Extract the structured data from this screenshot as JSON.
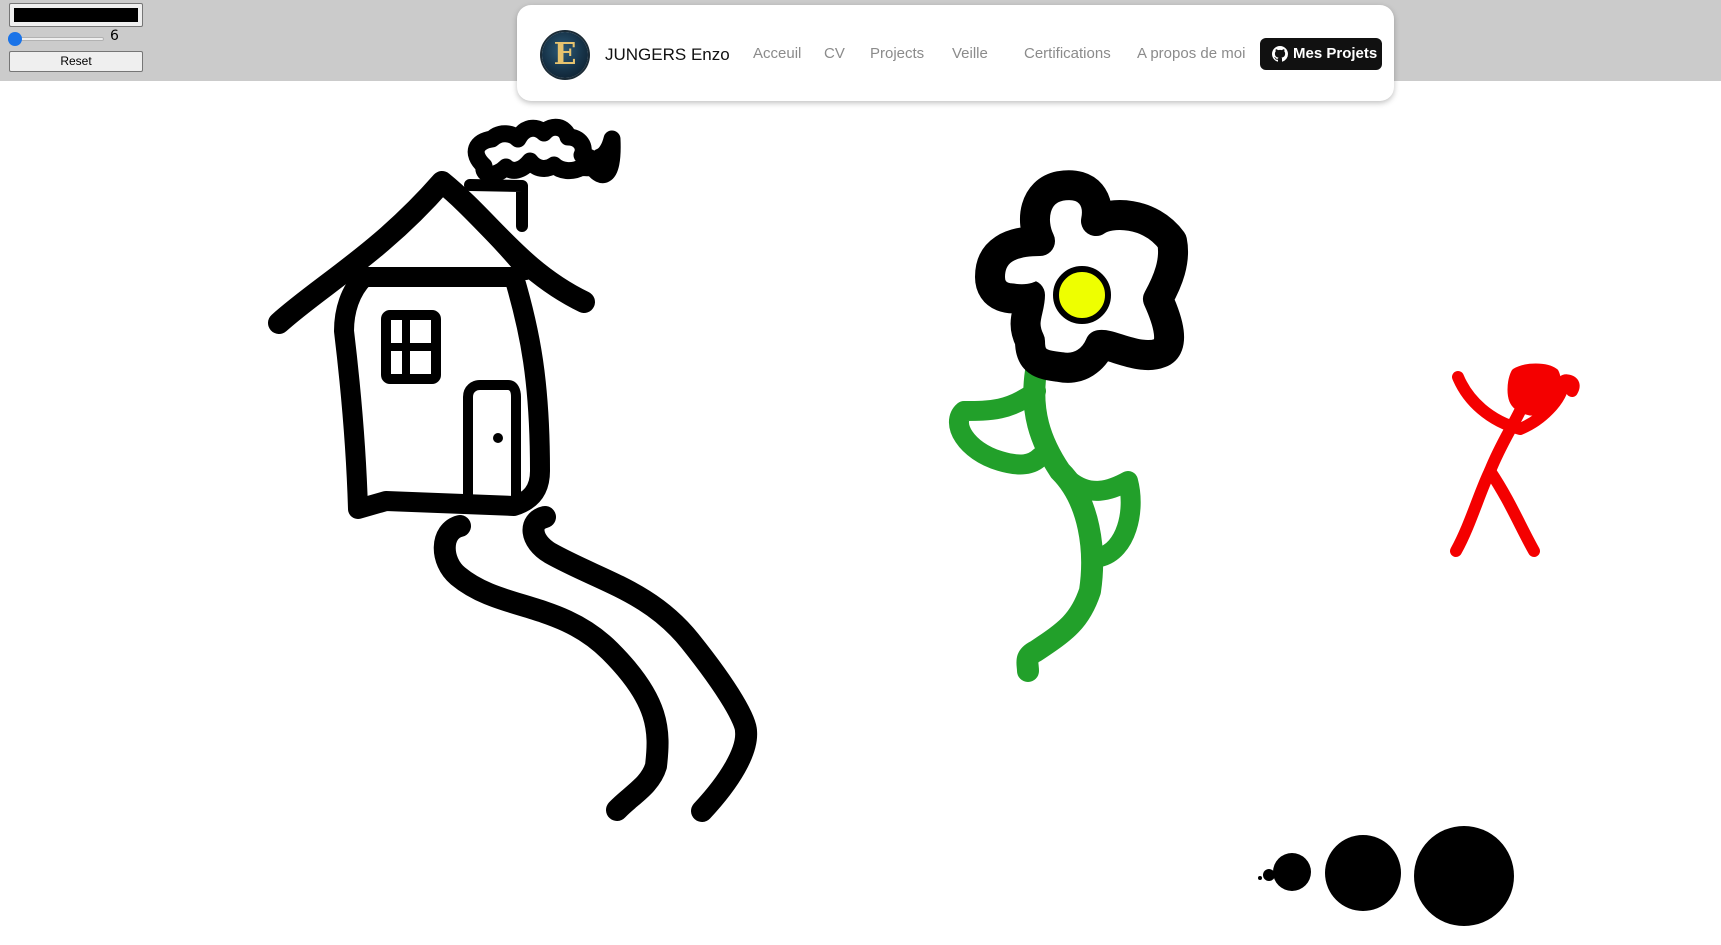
{
  "controls": {
    "color_value": "#000000",
    "brush_size": "6",
    "reset_label": "Reset"
  },
  "nav": {
    "brand_name": "JUNGERS Enzo",
    "logo_letter": "E",
    "links": [
      "Acceuil",
      "CV",
      "Projects",
      "Veille",
      "Certifications",
      "A propos de moi"
    ],
    "github_label": "Mes Projets"
  },
  "colors": {
    "topbar": "#cbcbcb",
    "house": "#000000",
    "stem": "#22a02a",
    "flower_center": "#eeff00",
    "person": "#f40000",
    "accent": "#1a73e8"
  },
  "icons": [
    "github-icon",
    "logo-e-icon"
  ]
}
